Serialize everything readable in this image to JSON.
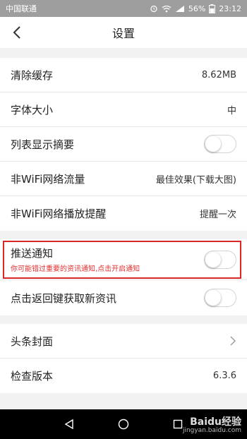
{
  "status_bar": {
    "carrier": "中国联通",
    "battery": "56%",
    "time": "23:12"
  },
  "header": {
    "title": "设置",
    "back_icon": "chevron-left-icon"
  },
  "group1": {
    "clear_cache": {
      "label": "清除缓存",
      "value": "8.62MB"
    },
    "font_size": {
      "label": "字体大小",
      "value": "中"
    },
    "list_summary": {
      "label": "列表显示摘要",
      "toggle": false
    },
    "non_wifi_traffic": {
      "label": "非WiFi网络流量",
      "value": "最佳效果(下载大图)"
    },
    "non_wifi_reminder": {
      "label": "非WiFi网络播放提醒",
      "value": "提醒一次"
    }
  },
  "group2": {
    "push": {
      "label": "推送通知",
      "sub": "你可能错过重要的资讯通知,点击开启通知",
      "toggle": false
    },
    "back_refresh": {
      "label": "点击返回键获取新资讯",
      "toggle": false
    }
  },
  "group3": {
    "cover": {
      "label": "头条封面"
    },
    "version": {
      "label": "检查版本",
      "value": "6.3.6"
    }
  },
  "watermark": {
    "brand": "Baidu经验",
    "url": "jingyan.baidu.com"
  },
  "colors": {
    "highlight_border": "#d92626",
    "sub_text": "#e03030"
  }
}
